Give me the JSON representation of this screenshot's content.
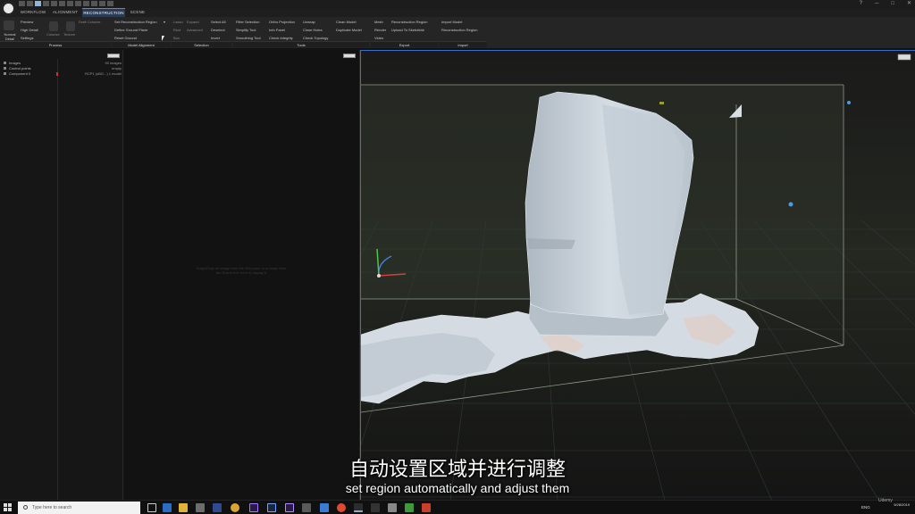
{
  "ribbon": {
    "tabs": [
      "WORKFLOW",
      "ALIGNMENT",
      "RECONSTRUCTION",
      "SCENE"
    ],
    "process": {
      "big_button_label": "Normal Detail",
      "items": [
        "Preview",
        "High Detail",
        "Settings"
      ],
      "secondary": [
        "Colorize",
        "Texture",
        "Draft Colorize"
      ],
      "group_label": "Process"
    },
    "model_alignment": {
      "items": [
        "Set Reconstruction Region",
        "Define Ground Plane",
        "Reset Ground"
      ],
      "group_label": "Model Alignment"
    },
    "selection": {
      "col1": [
        "Lasso",
        "Rect",
        "Box"
      ],
      "col2": [
        "Expand",
        "Advanced"
      ],
      "col3": [
        "Select All",
        "Deselect",
        "Invert"
      ],
      "group_label": "Selection"
    },
    "tools": {
      "col1": [
        "Filter Selection",
        "Simplify Tool",
        "Smoothing Tool"
      ],
      "col2": [
        "Ortho Projection",
        "Info Panel",
        "Check Integrity"
      ],
      "col3": [
        "Unwrap",
        "Close Holes",
        "Check Topology"
      ],
      "col4": [
        "Clean Model",
        "Duplicate Model"
      ],
      "group_label": "Tools"
    },
    "export": {
      "col1": [
        "Mesh",
        "Render",
        "Video"
      ],
      "col2": [
        "Reconstruction Region",
        "Upload To Sketchfab"
      ],
      "group_label": "Export"
    },
    "import": {
      "items": [
        "Import Model",
        "Reconstruction Region"
      ],
      "group_label": "Import"
    }
  },
  "left_panel": {
    "items": [
      {
        "label": "Images",
        "value": "90 images"
      },
      {
        "label": "Control points",
        "value": "empty"
      },
      {
        "label": "Component 0",
        "value": "RCP1 (sBG...) 1 model"
      }
    ]
  },
  "middle_panel": {
    "hint": "Drag&Drop an image from the 1Ds pane or a model from the Scene tree here to display it"
  },
  "taskbar": {
    "search_placeholder": "Type here to search",
    "lang": "ENG",
    "date": "9/28/2019"
  },
  "subtitles": {
    "chinese": "自动设置区域并进行调整",
    "english": "set region automatically and adjust them"
  },
  "watermark": "Udemy",
  "colors": {
    "accent": "#3a6fc8",
    "viewport_bg": "#1a1a1a",
    "model": "#c9d3dc",
    "recon_box": "#9aa89a"
  }
}
